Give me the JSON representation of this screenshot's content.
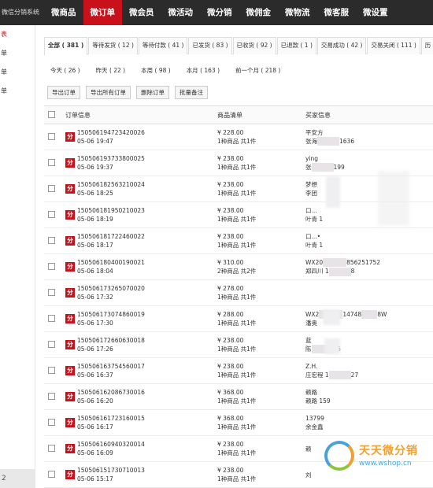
{
  "app": {
    "brand": "微信分销系统"
  },
  "nav": [
    {
      "label": "微商品",
      "active": false
    },
    {
      "label": "微订单",
      "active": true
    },
    {
      "label": "微会员",
      "active": false
    },
    {
      "label": "微活动",
      "active": false
    },
    {
      "label": "微分销",
      "active": false
    },
    {
      "label": "微佣金",
      "active": false
    },
    {
      "label": "微物流",
      "active": false
    },
    {
      "label": "微客服",
      "active": false
    },
    {
      "label": "微设置",
      "active": false
    }
  ],
  "sidebar": {
    "items": [
      "表",
      "单",
      "单",
      "单"
    ],
    "bottom": "2"
  },
  "status_tabs": [
    "全部 ( 381 )",
    "等待发货 ( 12 )",
    "等待付款 ( 41 )",
    "已发货 ( 83 )",
    "已收货 ( 92 )",
    "已退款 ( 1 )",
    "交易成功 ( 42 )",
    "交易关闭 ( 111 )",
    "历"
  ],
  "time_tabs": [
    "今天 ( 26 )",
    "昨天 ( 22 )",
    "本周 ( 98 )",
    "本月 ( 163 )",
    "前一个月 ( 218 )"
  ],
  "actions": [
    "导出订单",
    "导出所有订单",
    "删除订单",
    "批量备注"
  ],
  "table": {
    "headers": [
      "订单信息",
      "商品清单",
      "买家信息"
    ],
    "rows": [
      {
        "badge": "分",
        "id": "150506194723420026",
        "time": "05-06 19:47",
        "price": "¥ 228.00",
        "qty": "1种商品 共1件",
        "b1": "平安方",
        "b2": "张海",
        "b2tail": "1636"
      },
      {
        "badge": "分",
        "id": "150506193733800025",
        "time": "05-06 19:37",
        "price": "¥ 238.00",
        "qty": "1种商品 共1件",
        "b1": "ying",
        "b2": "张",
        "b2tail": "199"
      },
      {
        "badge": "分",
        "id": "150506182563210024",
        "time": "05-06 18:25",
        "price": "¥ 238.00",
        "qty": "1种商品 共1件",
        "b1": "梦想",
        "b2": "李团",
        "b2tail": ""
      },
      {
        "badge": "分",
        "id": "150506181950210023",
        "time": "05-06 18:19",
        "price": "¥ 238.00",
        "qty": "1种商品 共1件",
        "b1": "口...",
        "b2": "叶青 1",
        "b2tail": ""
      },
      {
        "badge": "分",
        "id": "150506181722460022",
        "time": "05-06 18:17",
        "price": "¥ 238.00",
        "qty": "1种商品 共1件",
        "b1": "口...•",
        "b2": "叶青 1",
        "b2tail": ""
      },
      {
        "badge": "分",
        "id": "150506180400190021",
        "time": "05-06 18:04",
        "price": "¥ 310.00",
        "qty": "2种商品 共2件",
        "b1": "WX20",
        "b1tail": "856251752",
        "b2": "郑四川 1",
        "b2tail": "8"
      },
      {
        "badge": "分",
        "id": "150506173265070020",
        "time": "05-06 17:32",
        "price": "¥ 278.00",
        "qty": "1种商品 共1件",
        "b1": "",
        "b2": "",
        "b2tail": ""
      },
      {
        "badge": "分",
        "id": "150506173074860019",
        "time": "05-06 17:30",
        "price": "¥ 288.00",
        "qty": "1种商品 共1件",
        "b1": "WX2",
        "b1tail": "14748",
        "b1tail2": "8W",
        "b2": "潘奥",
        "b2tail": ""
      },
      {
        "badge": "分",
        "id": "150506172660630018",
        "time": "05-06 17:26",
        "price": "¥ 238.00",
        "qty": "1种商品 共1件",
        "b1": "蓝",
        "b2": "陈",
        "b2tail": "55"
      },
      {
        "badge": "分",
        "id": "150506163754560017",
        "time": "05-06 16:37",
        "price": "¥ 238.00",
        "qty": "1种商品 共1件",
        "b1": "Z.H.",
        "b2": "庄宏程 1",
        "b2tail": "27"
      },
      {
        "badge": "分",
        "id": "150506162086730016",
        "time": "05-06 16:20",
        "price": "¥ 368.00",
        "qty": "1种商品 共1件",
        "b1": "赖路",
        "b2": "赖路 159",
        "b2tail": ""
      },
      {
        "badge": "分",
        "id": "150506161723160015",
        "time": "05-06 16:17",
        "price": "¥ 368.00",
        "qty": "1种商品 共1件",
        "b1": "13799",
        "b2": "余金鑫",
        "b2tail": ""
      },
      {
        "badge": "分",
        "id": "150506160940320014",
        "time": "05-06 16:09",
        "price": "¥ 238.00",
        "qty": "1种商品 共1件",
        "b1": "赖",
        "b2": "",
        "b2tail": ""
      },
      {
        "badge": "分",
        "id": "150506151730710013",
        "time": "05-06 15:17",
        "price": "¥ 238.00",
        "qty": "1种商品 共1件",
        "b1": "",
        "b2": "刘",
        "b2tail": ""
      }
    ]
  },
  "watermark": {
    "title": "天天微分销",
    "url": "www.wshop.cn"
  },
  "colors": {
    "accent": "#c8111a",
    "topbar": "#2b2b2b"
  }
}
